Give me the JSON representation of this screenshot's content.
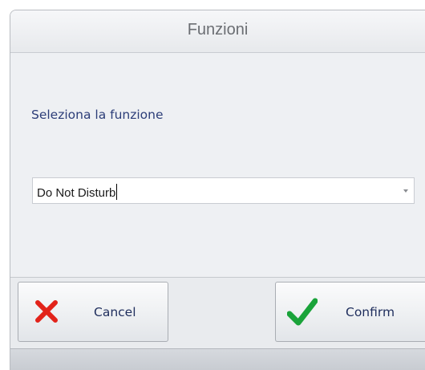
{
  "window": {
    "title": "Funzioni"
  },
  "form": {
    "prompt": "Seleziona la funzione",
    "function_select": {
      "value": "Do Not Disturb"
    }
  },
  "buttons": {
    "cancel_label": "Cancel",
    "cancel_icon": "close-icon",
    "cancel_icon_color": "#e2231a",
    "confirm_label": "Confirm",
    "confirm_icon": "checkmark-icon",
    "confirm_icon_color": "#1aa33a"
  }
}
